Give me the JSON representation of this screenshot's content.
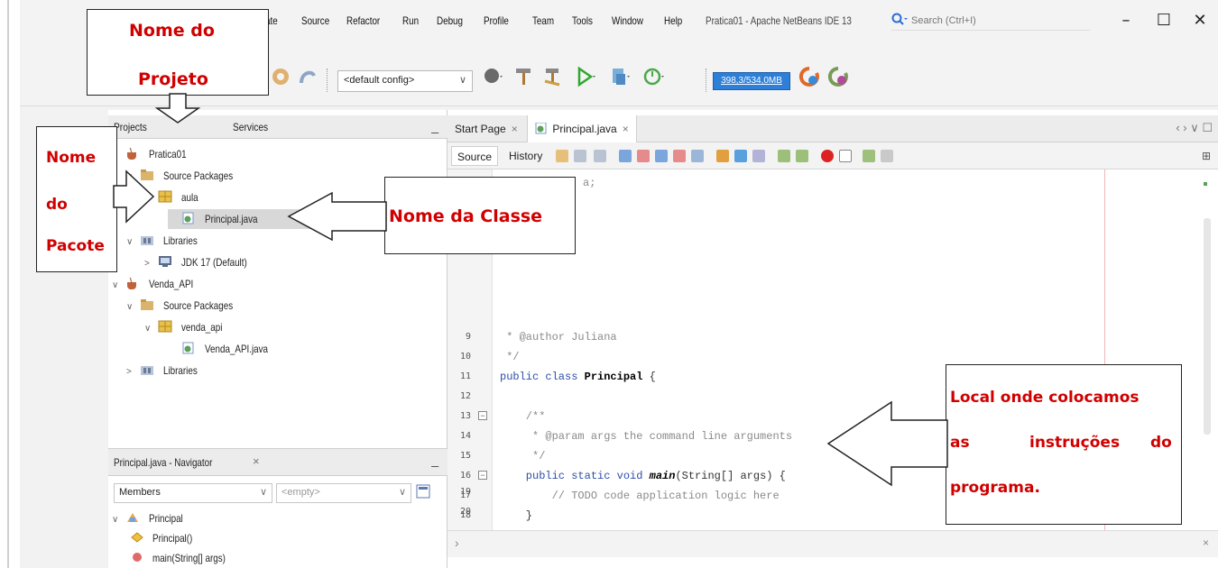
{
  "menu": {
    "items": [
      "ate",
      "Source",
      "Refactor",
      "Run",
      "Debug",
      "Profile",
      "Team",
      "Tools",
      "Window",
      "Help"
    ]
  },
  "window": {
    "title": "Pratica01 - Apache NetBeans IDE 13",
    "search_placeholder": "Search (Ctrl+I)",
    "minimize": "–",
    "maximize": "☐",
    "close": "✕"
  },
  "toolbar": {
    "config": "<default config>",
    "memory": "398,3/534,0MB"
  },
  "projects": {
    "tabs": [
      "Projects",
      "Services"
    ],
    "tree": [
      {
        "label": "Pratica01",
        "arrow": "∨"
      },
      {
        "label": "Source Packages",
        "arrow": "∨"
      },
      {
        "label": "aula",
        "arrow": "∨"
      },
      {
        "label": "Principal.java",
        "arrow": ""
      },
      {
        "label": "Libraries",
        "arrow": "∨"
      },
      {
        "label": "JDK 17 (Default)",
        "arrow": ">"
      },
      {
        "label": "Venda_API",
        "arrow": "∨"
      },
      {
        "label": "Source Packages",
        "arrow": "∨"
      },
      {
        "label": "venda_api",
        "arrow": "∨"
      },
      {
        "label": "Venda_API.java",
        "arrow": ""
      },
      {
        "label": "Libraries",
        "arrow": ">"
      }
    ]
  },
  "navigator": {
    "title": "Principal.java - Navigator",
    "close": "×",
    "members": "Members",
    "filter": "<empty>",
    "tree": [
      "Principal",
      "Principal()",
      "main(String[] args)"
    ]
  },
  "editor": {
    "tabs": [
      {
        "label": "Start Page",
        "close": "×"
      },
      {
        "label": "Principal.java",
        "close": "×"
      }
    ],
    "source_label": "Source",
    "history_label": "History",
    "nav_arrows": "‹ › ∨ ☐",
    "lines": [
      {
        "num": "",
        "text": "a;"
      },
      {
        "num": "9",
        "text": " * @author Juliana"
      },
      {
        "num": "10",
        "text": " */"
      },
      {
        "num": "11",
        "text": "public class Principal {"
      },
      {
        "num": "12",
        "text": ""
      },
      {
        "num": "13",
        "text": "    /**"
      },
      {
        "num": "14",
        "text": "     * @param args the command line arguments"
      },
      {
        "num": "15",
        "text": "     */"
      },
      {
        "num": "16",
        "text": "    public static void main(String[] args) {"
      },
      {
        "num": "17",
        "text": "        // TODO code application logic here"
      },
      {
        "num": "18",
        "text": "    }"
      },
      {
        "num": "19",
        "text": ""
      },
      {
        "num": "20",
        "text": "}"
      }
    ]
  },
  "annotations": {
    "project_name_1": "Nome do",
    "project_name_2": "Projeto",
    "package_1": "Nome",
    "package_2": "do",
    "package_3": "Pacote",
    "class_name": "Nome da Classe",
    "instructions_1": "Local onde colocamos",
    "instructions_2a": "as",
    "instructions_2b": "instruções",
    "instructions_2c": "do",
    "instructions_3": "programa."
  },
  "colors": {
    "annotation_text": "#d00000",
    "memory_bar": "#2d7fd8",
    "keyword": "#2d4fa7"
  }
}
